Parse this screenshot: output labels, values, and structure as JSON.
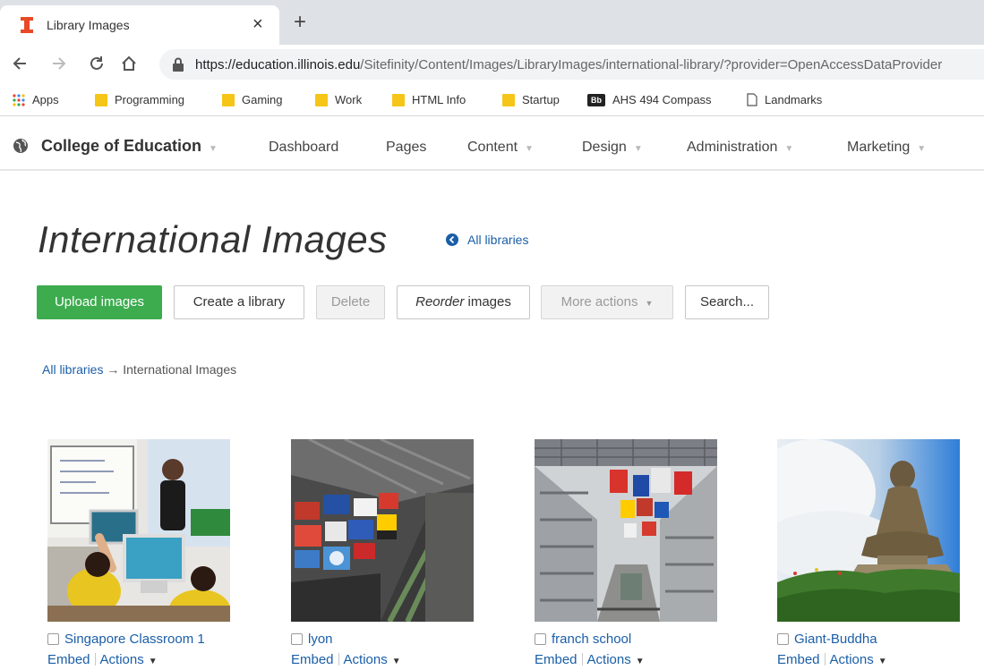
{
  "browser": {
    "tab_title": "Library Images",
    "tab_close": "×",
    "new_tab": "+",
    "url_host": "https://education.illinois.edu",
    "url_path": "/Sitefinity/Content/Images/LibraryImages/international-library/?provider=OpenAccessDataProvider",
    "bookmarks": [
      {
        "label": "Apps"
      },
      {
        "label": "Programming"
      },
      {
        "label": "Gaming"
      },
      {
        "label": "Work"
      },
      {
        "label": "HTML Info"
      },
      {
        "label": "Startup"
      },
      {
        "label": "AHS 494 Compass",
        "badge": "Bb"
      },
      {
        "label": "Landmarks"
      }
    ]
  },
  "appnav": {
    "brand": "College of Education",
    "items": [
      {
        "label": "Dashboard"
      },
      {
        "label": "Pages"
      },
      {
        "label": "Content"
      },
      {
        "label": "Design"
      },
      {
        "label": "Administration"
      },
      {
        "label": "Marketing"
      }
    ]
  },
  "page": {
    "title": "International Images",
    "all_libraries_link": "All libraries",
    "buttons": {
      "upload": "Upload images",
      "create": "Create a library",
      "delete": "Delete",
      "reorder_italic": "Reorder",
      "reorder_rest": " images",
      "more": "More actions",
      "search": "Search..."
    },
    "breadcrumb": {
      "root": "All libraries",
      "arrow": " → ",
      "current": "International Images"
    }
  },
  "images": [
    {
      "title": "Singapore Classroom 1",
      "embed": "Embed",
      "actions": "Actions"
    },
    {
      "title": "lyon",
      "embed": "Embed",
      "actions": "Actions"
    },
    {
      "title": "franch school",
      "embed": "Embed",
      "actions": "Actions"
    },
    {
      "title": "Giant-Buddha",
      "embed": "Embed",
      "actions": "Actions"
    }
  ],
  "colors": {
    "accent_green": "#3dac4f",
    "link_blue": "#1a5ea8",
    "chrome_gray": "#dee1e6"
  }
}
